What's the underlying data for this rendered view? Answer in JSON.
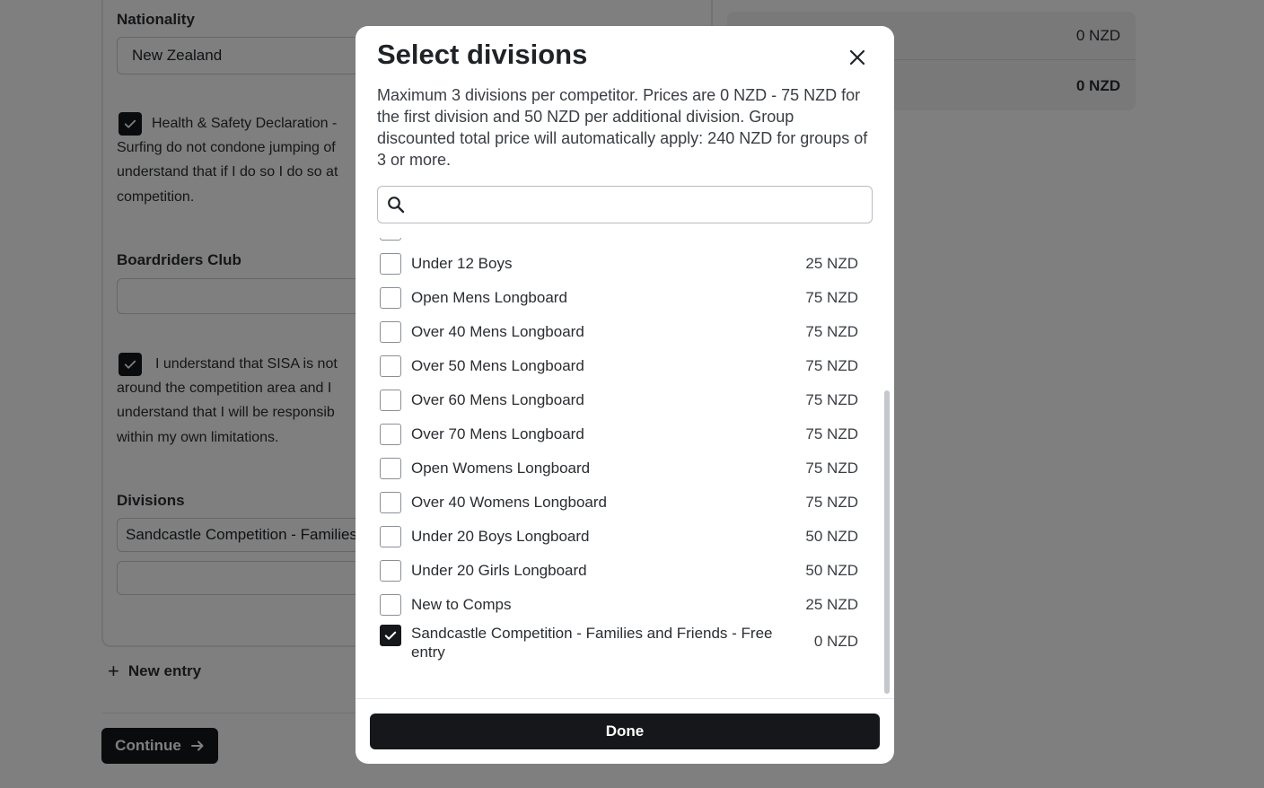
{
  "background": {
    "nationality_label": "Nationality",
    "nationality_value": "New Zealand",
    "health_safety_lines": [
      "Health & Safety Declaration - ",
      "Surfing do not condone jumping of",
      "understand that if I do so I do so at",
      "competition."
    ],
    "boardriders_label": "Boardriders Club",
    "boardriders_value": "",
    "sisa_lines": [
      "I understand that SISA is not",
      "around the competition area and I",
      "understand that I will be responsib",
      "within my own limitations."
    ],
    "divisions_label": "Divisions",
    "division_selected_value": "Sandcastle Competition - Families",
    "division_empty_value": "",
    "new_entry_label": "New entry",
    "continue_label": "Continue",
    "summary_row1_value": "0 NZD",
    "summary_total_value": "0 NZD"
  },
  "modal": {
    "title": "Select divisions",
    "description": "Maximum 3 divisions per competitor. Prices are 0 NZD - 75 NZD for the first division and 50 NZD per additional division. Group discounted total price will automatically apply: 240 NZD for groups of 3 or more.",
    "search_placeholder": "",
    "search_value": "",
    "done_label": "Done",
    "divisions": [
      {
        "label": "",
        "price": "",
        "checked": false
      },
      {
        "label": "Under 12 Boys",
        "price": "25 NZD",
        "checked": false
      },
      {
        "label": "Open Mens Longboard",
        "price": "75 NZD",
        "checked": false
      },
      {
        "label": "Over 40 Mens Longboard",
        "price": "75 NZD",
        "checked": false
      },
      {
        "label": "Over 50 Mens Longboard",
        "price": "75 NZD",
        "checked": false
      },
      {
        "label": "Over 60 Mens Longboard",
        "price": "75 NZD",
        "checked": false
      },
      {
        "label": "Over 70 Mens Longboard",
        "price": "75 NZD",
        "checked": false
      },
      {
        "label": "Open Womens Longboard",
        "price": "75 NZD",
        "checked": false
      },
      {
        "label": "Over 40 Womens Longboard",
        "price": "75 NZD",
        "checked": false
      },
      {
        "label": "Under 20 Boys Longboard",
        "price": "50 NZD",
        "checked": false
      },
      {
        "label": "Under 20 Girls Longboard",
        "price": "50 NZD",
        "checked": false
      },
      {
        "label": "New to Comps",
        "price": "25 NZD",
        "checked": false
      },
      {
        "label": "Sandcastle Competition - Families and Friends - Free entry",
        "price": "0 NZD",
        "checked": true
      }
    ]
  },
  "colors": {
    "overlay": "#000000",
    "primary": "#15171a",
    "surface": "#ffffff"
  }
}
